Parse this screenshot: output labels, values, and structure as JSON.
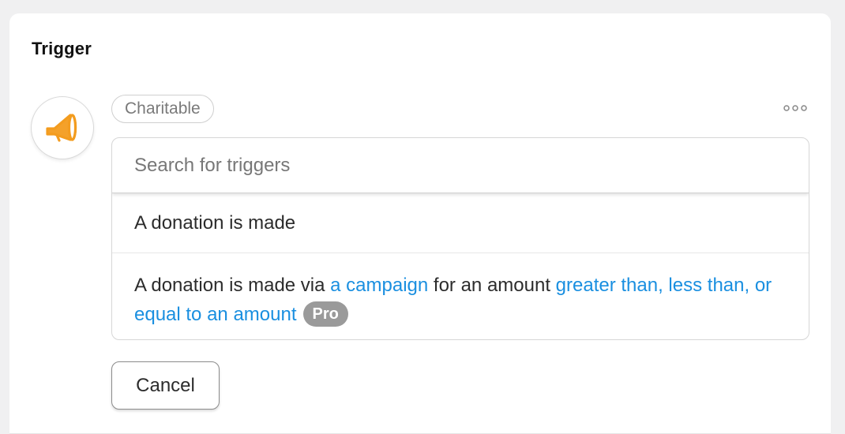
{
  "panel": {
    "title": "Trigger"
  },
  "integration": {
    "icon": "megaphone-icon",
    "name": "Charitable",
    "accent_color": "#f39c1f"
  },
  "search": {
    "placeholder": "Search for triggers",
    "value": ""
  },
  "triggers": [
    {
      "label": "A donation is made"
    },
    {
      "parts": [
        "A donation is made via ",
        "a campaign",
        " for an amount ",
        "greater than, less than, or equal to an amount"
      ],
      "badge": "Pro"
    }
  ],
  "actions": {
    "cancel_label": "Cancel"
  },
  "colors": {
    "link": "#1a8fe0",
    "badge_bg": "#9a9a9a"
  }
}
